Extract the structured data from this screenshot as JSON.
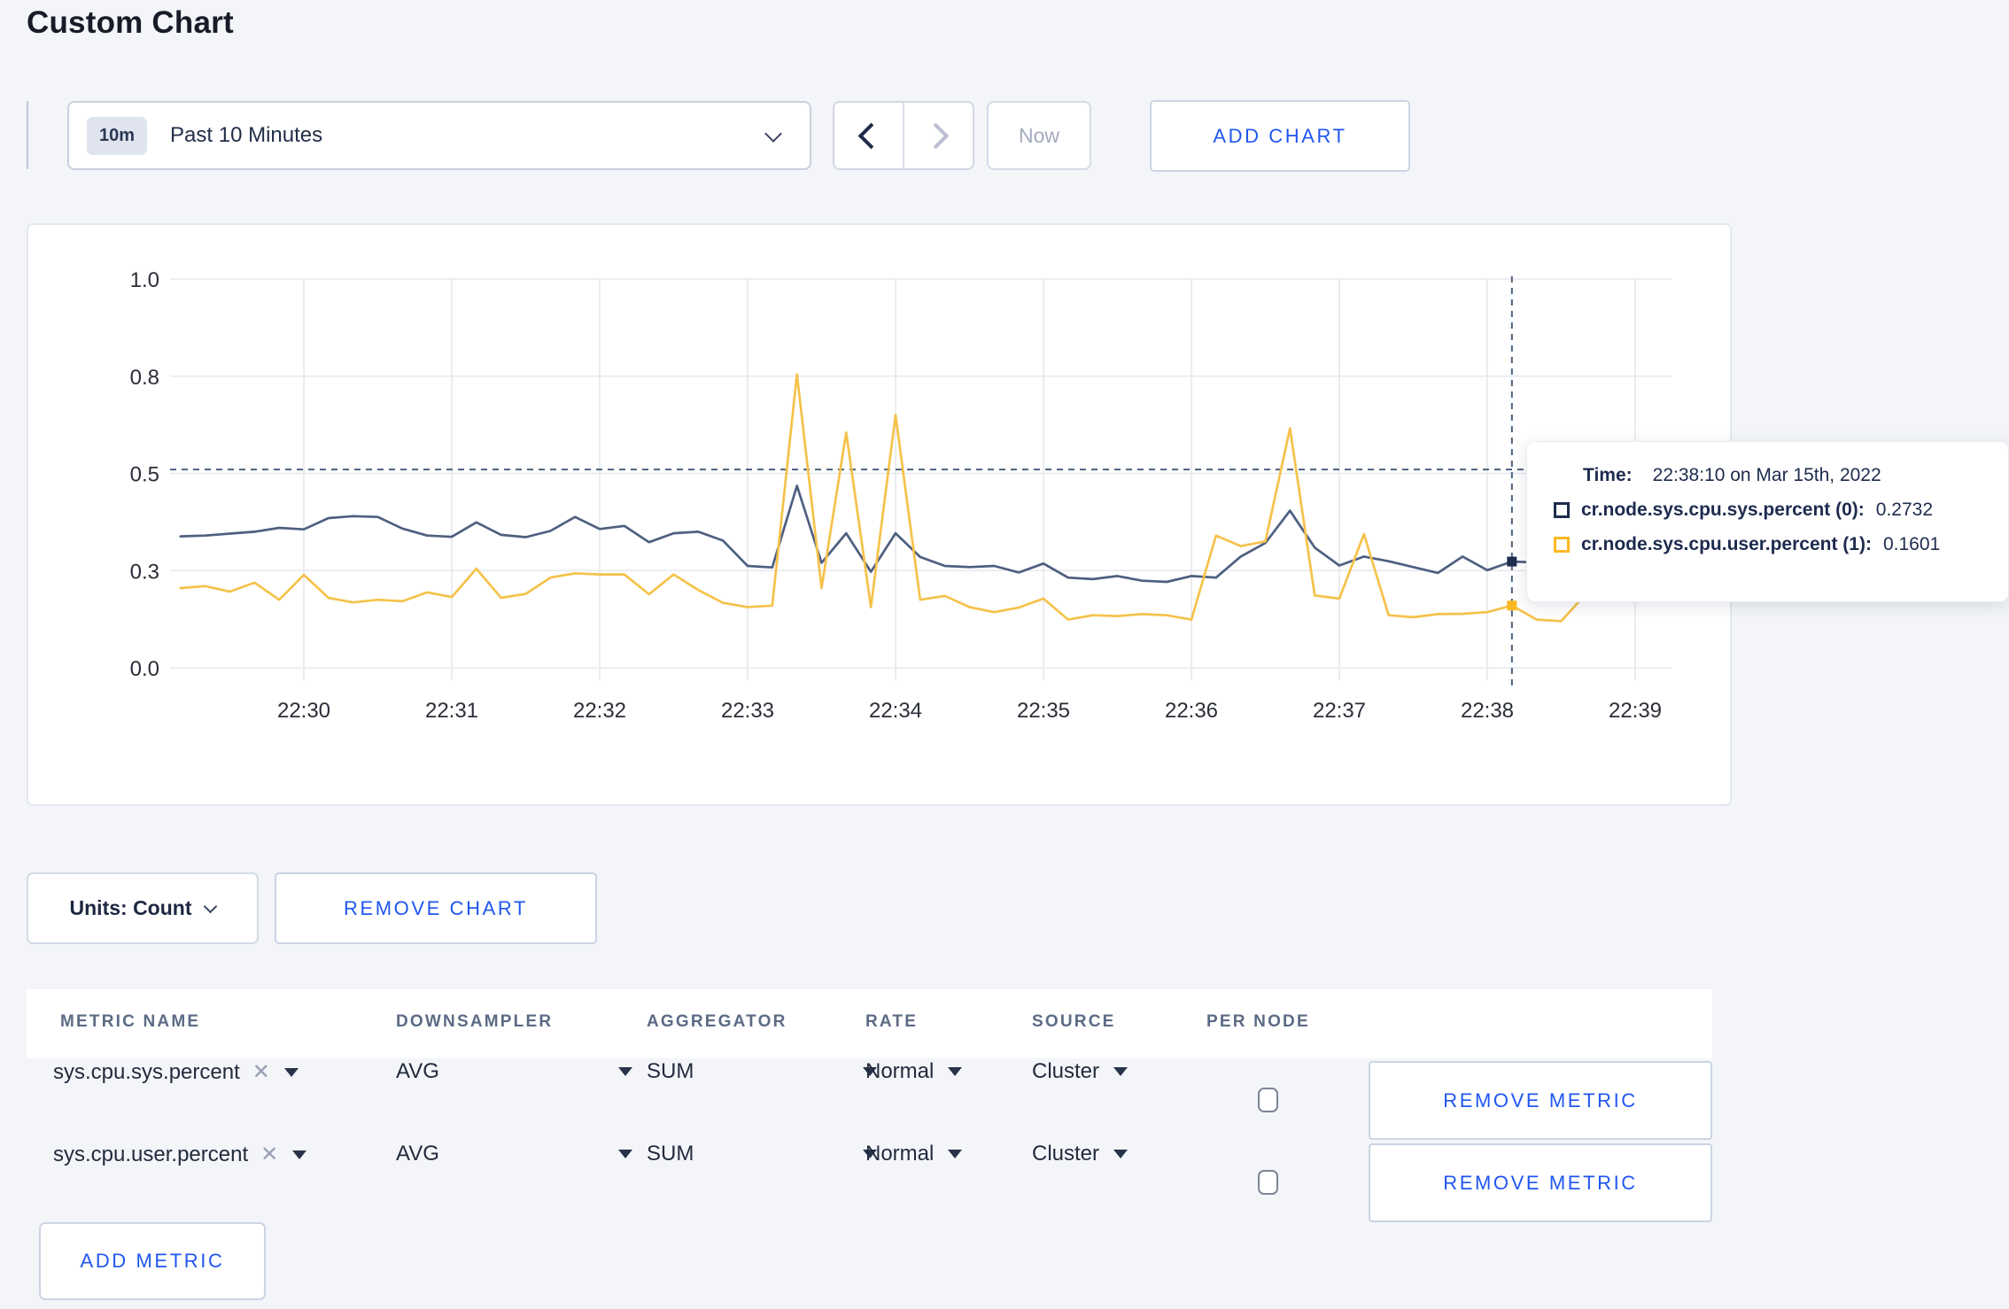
{
  "page": {
    "title": "Custom Chart"
  },
  "toolbar": {
    "time_range_badge": "10m",
    "time_range_label": "Past 10 Minutes",
    "now_label": "Now",
    "add_chart_label": "ADD CHART"
  },
  "chart_controls": {
    "units_label": "Units: Count",
    "remove_chart_label": "REMOVE CHART"
  },
  "tooltip": {
    "time_label": "Time:",
    "time_value": "22:38:10 on Mar 15th, 2022",
    "series": [
      {
        "label": "cr.node.sys.cpu.sys.percent (0):",
        "value": "0.2732",
        "swatch_color": "#1e2c4d"
      },
      {
        "label": "cr.node.sys.cpu.user.percent (1):",
        "value": "0.1601",
        "swatch_color": "#fcb822"
      }
    ]
  },
  "chart_data": {
    "type": "line",
    "title": "",
    "xlabel": "",
    "ylabel": "",
    "ylim": [
      0,
      1
    ],
    "grid": true,
    "x_start": "22:29:10",
    "x_interval_s": 10,
    "x_ticks": [
      "22:30",
      "22:31",
      "22:32",
      "22:33",
      "22:34",
      "22:35",
      "22:36",
      "22:37",
      "22:38",
      "22:39"
    ],
    "y_ticks": [
      {
        "value": 0,
        "label": "0.0"
      },
      {
        "value": 0.25,
        "label": "0.3"
      },
      {
        "value": 0.5,
        "label": "0.5"
      },
      {
        "value": 0.75,
        "label": "0.8"
      },
      {
        "value": 1,
        "label": "1.0"
      }
    ],
    "hover": {
      "time": "22:38:10",
      "guide_value": 0.51
    },
    "series": [
      {
        "name": "cr.node.sys.cpu.sys.percent",
        "color": "#4e5f80",
        "marker_color": "#1e2c4d",
        "values": [
          0.338,
          0.34,
          0.345,
          0.35,
          0.36,
          0.356,
          0.385,
          0.39,
          0.388,
          0.358,
          0.34,
          0.337,
          0.374,
          0.342,
          0.336,
          0.352,
          0.388,
          0.357,
          0.365,
          0.323,
          0.346,
          0.35,
          0.327,
          0.262,
          0.258,
          0.468,
          0.27,
          0.346,
          0.247,
          0.346,
          0.285,
          0.262,
          0.259,
          0.262,
          0.245,
          0.268,
          0.232,
          0.228,
          0.236,
          0.224,
          0.221,
          0.236,
          0.232,
          0.286,
          0.321,
          0.404,
          0.309,
          0.263,
          0.286,
          0.274,
          0.259,
          0.244,
          0.286,
          0.251,
          0.2732,
          0.271,
          0.268,
          0.262,
          0.266,
          0.263,
          0.262
        ]
      },
      {
        "name": "cr.node.sys.cpu.user.percent",
        "color": "#f5c24a",
        "marker_color": "#fcb822",
        "values": [
          0.205,
          0.21,
          0.196,
          0.219,
          0.175,
          0.239,
          0.18,
          0.168,
          0.175,
          0.171,
          0.194,
          0.182,
          0.255,
          0.18,
          0.19,
          0.232,
          0.243,
          0.24,
          0.24,
          0.189,
          0.24,
          0.2,
          0.167,
          0.156,
          0.16,
          0.755,
          0.205,
          0.605,
          0.156,
          0.65,
          0.175,
          0.185,
          0.156,
          0.143,
          0.155,
          0.178,
          0.124,
          0.135,
          0.133,
          0.138,
          0.135,
          0.124,
          0.34,
          0.313,
          0.325,
          0.616,
          0.186,
          0.178,
          0.344,
          0.135,
          0.13,
          0.138,
          0.139,
          0.143,
          0.1601,
          0.124,
          0.12,
          0.19,
          0.3,
          0.185,
          0.27
        ]
      }
    ]
  },
  "metrics_table": {
    "headers": [
      "METRIC NAME",
      "DOWNSAMPLER",
      "AGGREGATOR",
      "RATE",
      "SOURCE",
      "PER NODE"
    ],
    "rows": [
      {
        "metric": "sys.cpu.sys.percent",
        "downsampler": "AVG",
        "aggregator": "SUM",
        "rate": "Normal",
        "source": "Cluster",
        "per_node_checked": false
      },
      {
        "metric": "sys.cpu.user.percent",
        "downsampler": "AVG",
        "aggregator": "SUM",
        "rate": "Normal",
        "source": "Cluster",
        "per_node_checked": false
      }
    ],
    "remove_metric_label": "REMOVE METRIC",
    "add_metric_label": "ADD METRIC"
  }
}
